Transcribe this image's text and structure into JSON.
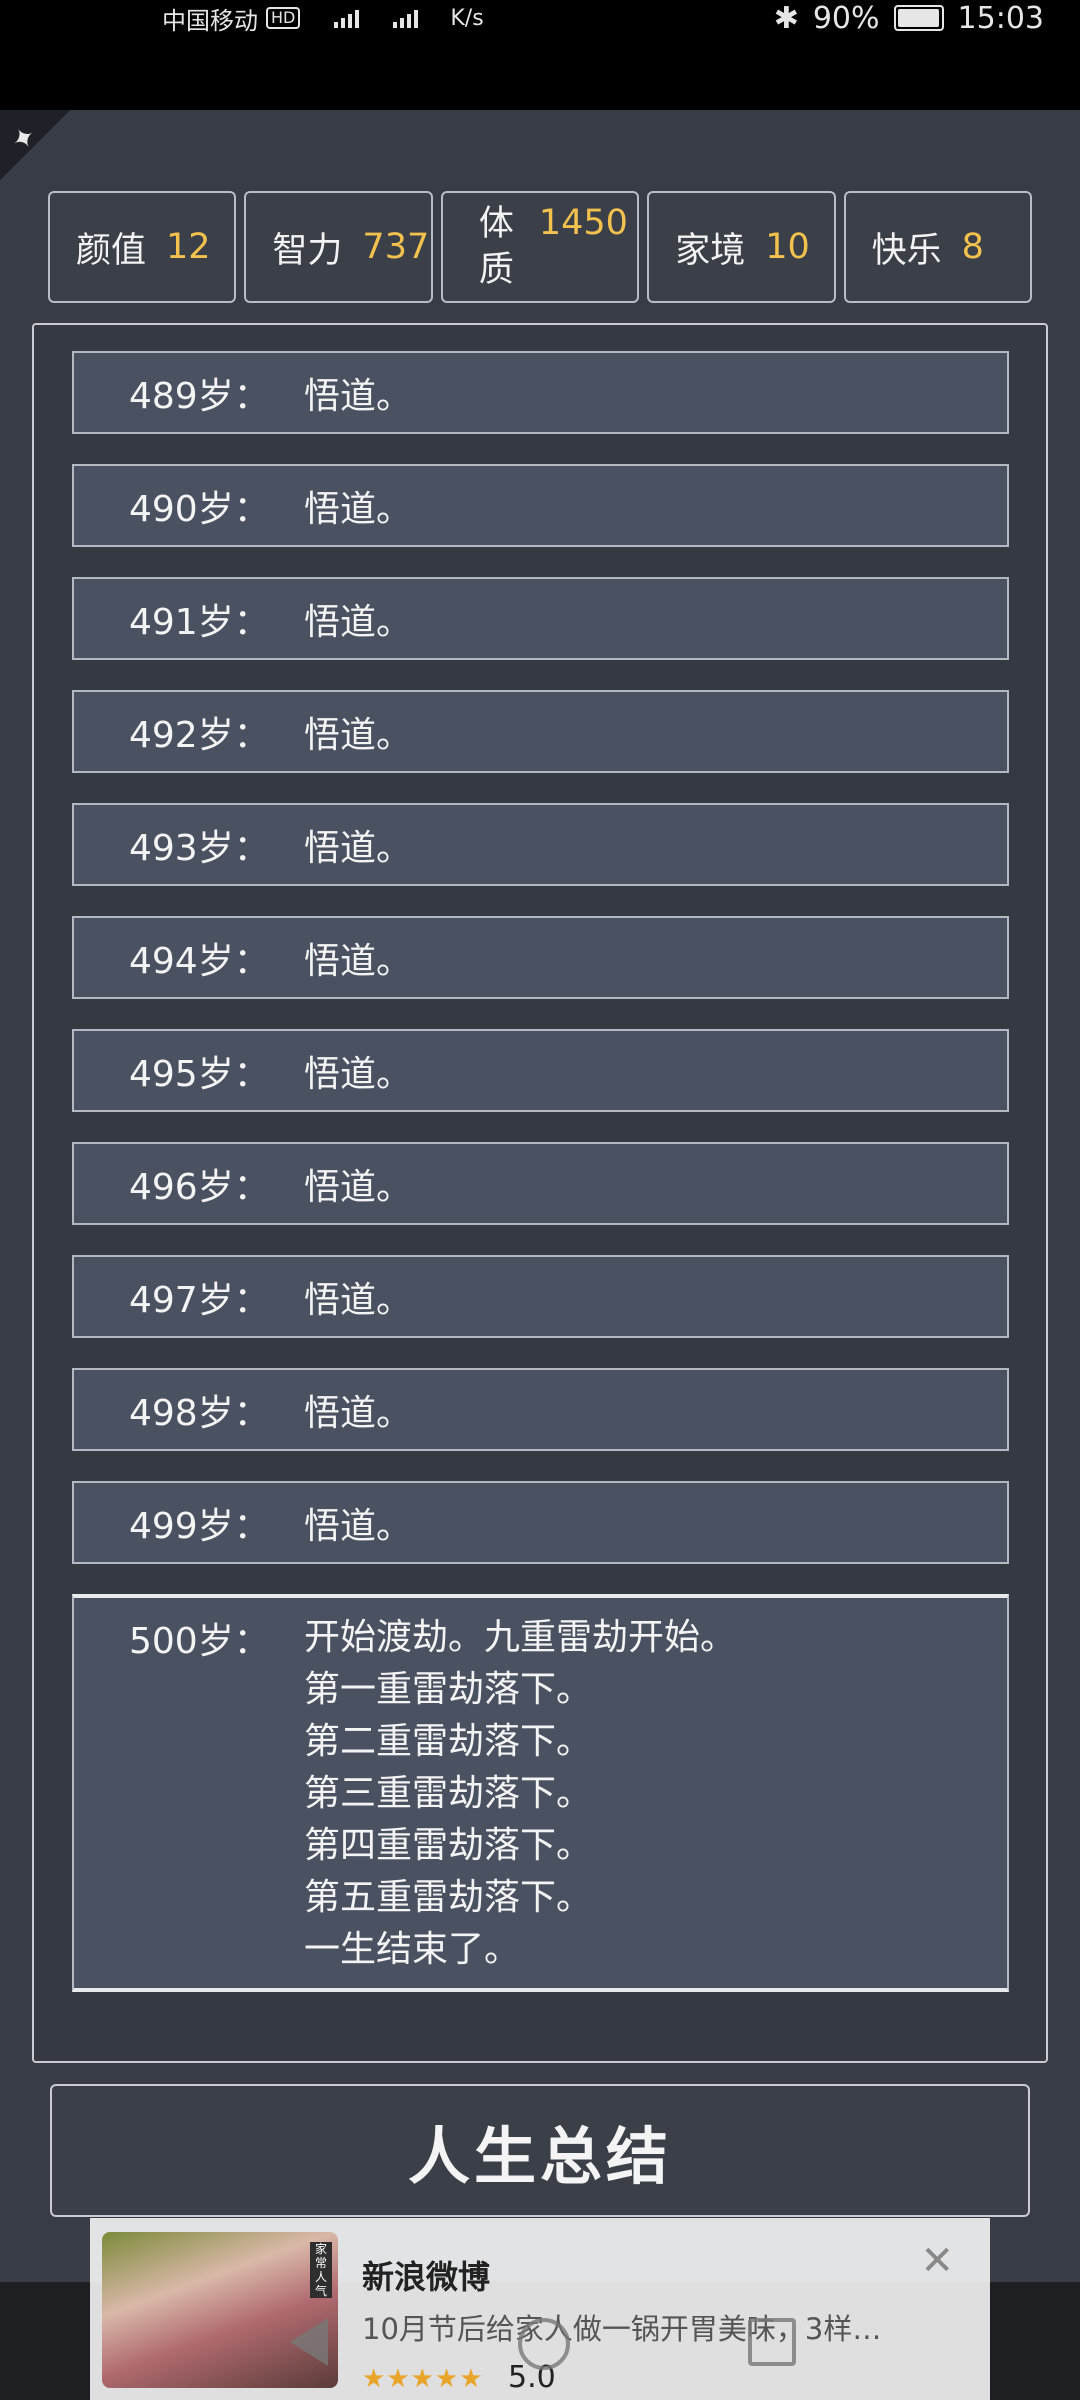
{
  "status_bar": {
    "carrier": "中国移动",
    "hd": "HD",
    "speed": "K/s",
    "battery": "90%",
    "time": "15:03"
  },
  "attributes": [
    {
      "name": "颜值",
      "value": "12"
    },
    {
      "name": "智力",
      "value": "737"
    },
    {
      "name": "体质",
      "value": "1450"
    },
    {
      "name": "家境",
      "value": "10"
    },
    {
      "name": "快乐",
      "value": "8"
    }
  ],
  "log": [
    {
      "age": "489岁：",
      "text": "悟道。"
    },
    {
      "age": "490岁：",
      "text": "悟道。"
    },
    {
      "age": "491岁：",
      "text": "悟道。"
    },
    {
      "age": "492岁：",
      "text": "悟道。"
    },
    {
      "age": "493岁：",
      "text": "悟道。"
    },
    {
      "age": "494岁：",
      "text": "悟道。"
    },
    {
      "age": "495岁：",
      "text": "悟道。"
    },
    {
      "age": "496岁：",
      "text": "悟道。"
    },
    {
      "age": "497岁：",
      "text": "悟道。"
    },
    {
      "age": "498岁：",
      "text": "悟道。"
    },
    {
      "age": "499岁：",
      "text": "悟道。"
    }
  ],
  "final_entry": {
    "age": "500岁：",
    "lines": [
      "开始渡劫。九重雷劫开始。",
      "第一重雷劫落下。",
      "第二重雷劫落下。",
      "第三重雷劫落下。",
      "第四重雷劫落下。",
      "第五重雷劫落下。",
      "一生结束了。"
    ]
  },
  "summary_button": "人生总结",
  "ad": {
    "title": "新浪微博",
    "description": "10月节后给家人做一锅开胃美味，3样…",
    "stars": "★★★★★",
    "rating": "5.0",
    "close": "✕",
    "thumb_tag": "家常人气"
  },
  "colors": {
    "background": "#373c45",
    "row_fill": "#4a5160",
    "accent_value": "#f2c14e"
  }
}
